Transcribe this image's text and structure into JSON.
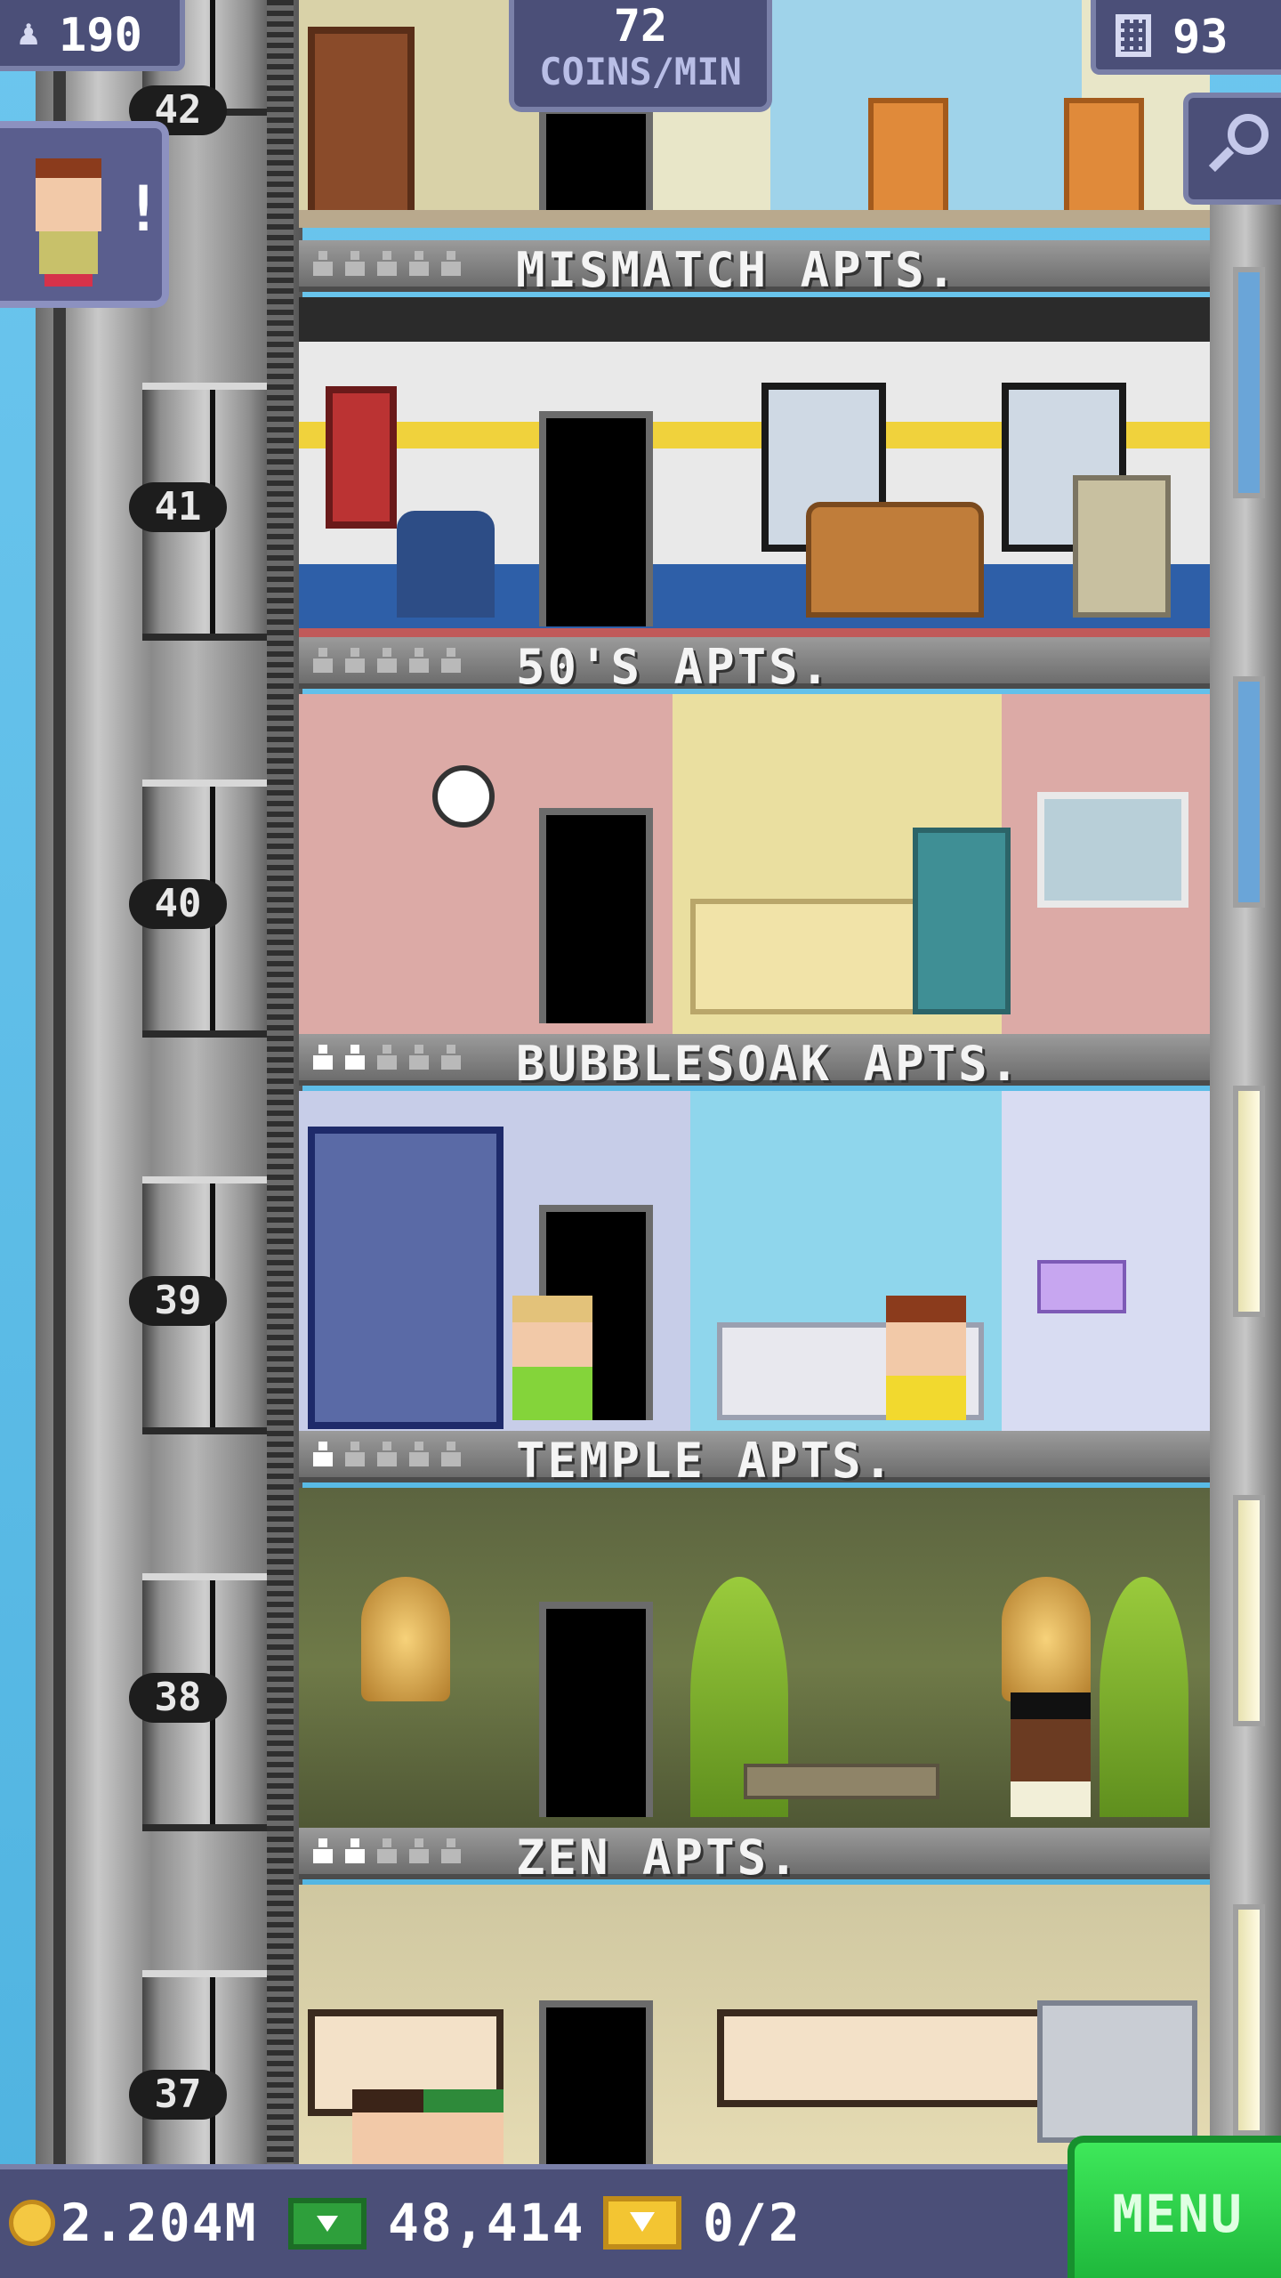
{
  "hud": {
    "population": "190",
    "coins_per_min_value": "72",
    "coins_per_min_unit": "COINS/MIN",
    "floor_count": "93"
  },
  "shaft": {
    "floor_numbers": [
      "42",
      "41",
      "40",
      "39",
      "38",
      "37"
    ]
  },
  "floors": [
    {
      "name": "MISMATCH APTS.",
      "residents": 0,
      "capacity": 5
    },
    {
      "name": "50'S APTS.",
      "residents": 0,
      "capacity": 5
    },
    {
      "name": "BUBBLESOAK APTS.",
      "residents": 2,
      "capacity": 5
    },
    {
      "name": "TEMPLE APTS.",
      "residents": 1,
      "capacity": 5
    },
    {
      "name": "ZEN APTS.",
      "residents": 2,
      "capacity": 5
    }
  ],
  "bottom": {
    "coins": "2.204M",
    "bux": "48,414",
    "tickets": "0/2",
    "menu_label": "MENU"
  },
  "icons": {
    "population": "person-icon",
    "floors": "building-icon",
    "search": "magnifier-icon",
    "coins": "coin-icon",
    "bux": "cash-icon",
    "tickets": "ticket-icon"
  },
  "colors": {
    "hud_bg": "#4b4f78",
    "hud_border": "#7a80a8",
    "menu_green": "#2fd44c"
  }
}
